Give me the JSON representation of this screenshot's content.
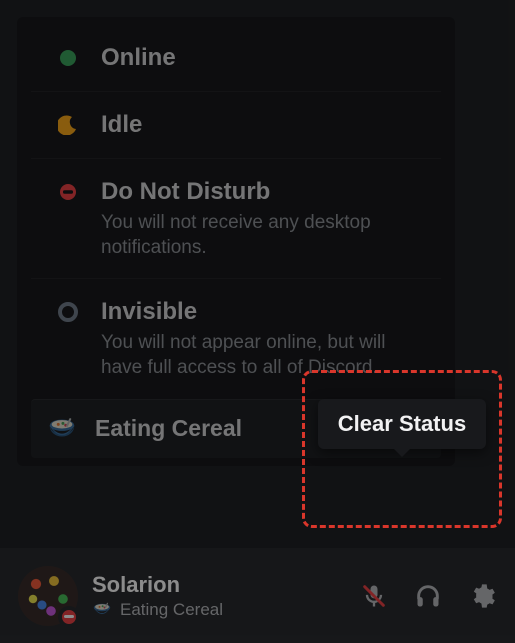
{
  "status_options": [
    {
      "key": "online",
      "label": "Online",
      "desc": ""
    },
    {
      "key": "idle",
      "label": "Idle",
      "desc": ""
    },
    {
      "key": "dnd",
      "label": "Do Not Disturb",
      "desc": "You will not receive any desktop notifications."
    },
    {
      "key": "invisible",
      "label": "Invisible",
      "desc": "You will not appear online, but will have full access to all of Discord."
    }
  ],
  "custom_status": {
    "emoji_name": "bowl-cereal",
    "text": "Eating Cereal"
  },
  "tooltip": {
    "clear_status": "Clear Status"
  },
  "user": {
    "name": "Solarion",
    "status_emoji_name": "bowl-cereal",
    "status_text": "Eating Cereal",
    "presence": "dnd"
  },
  "colors": {
    "online": "#3ba55d",
    "idle": "#faa81a",
    "dnd": "#ed4245",
    "invisible": "#747f8d",
    "highlight": "#d9362b"
  }
}
